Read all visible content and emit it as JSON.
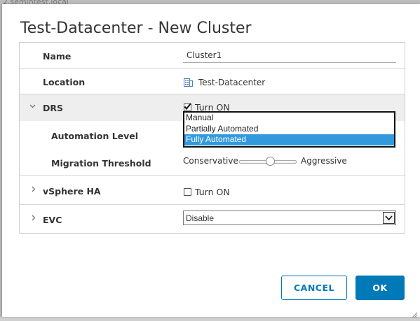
{
  "background": {
    "caption": "2.semintest.local"
  },
  "dialog": {
    "title": "Test-Datacenter - New Cluster",
    "name_row": {
      "label": "Name",
      "value": "Cluster1"
    },
    "location_row": {
      "label": "Location",
      "value": "Test-Datacenter",
      "icon": "datacenter-icon"
    },
    "drs_row": {
      "label": "DRS",
      "checkbox_label": "Turn ON",
      "checked": true,
      "expanded": true
    },
    "automation_row": {
      "label": "Automation Level",
      "options": [
        "Manual",
        "Partially Automated",
        "Fully Automated"
      ],
      "selected": "Fully Automated"
    },
    "migration_row": {
      "label": "Migration Threshold",
      "min_label": "Conservative",
      "max_label": "Aggressive",
      "level_fraction": 0.5
    },
    "ha_row": {
      "label": "vSphere HA",
      "checkbox_label": "Turn ON",
      "checked": false
    },
    "evc_row": {
      "label": "EVC",
      "value": "Disable"
    },
    "buttons": {
      "cancel": "CANCEL",
      "ok": "OK"
    },
    "colors": {
      "primary": "#0079b8",
      "selection": "#3399dd",
      "row_shade": "#eeeeee"
    }
  }
}
